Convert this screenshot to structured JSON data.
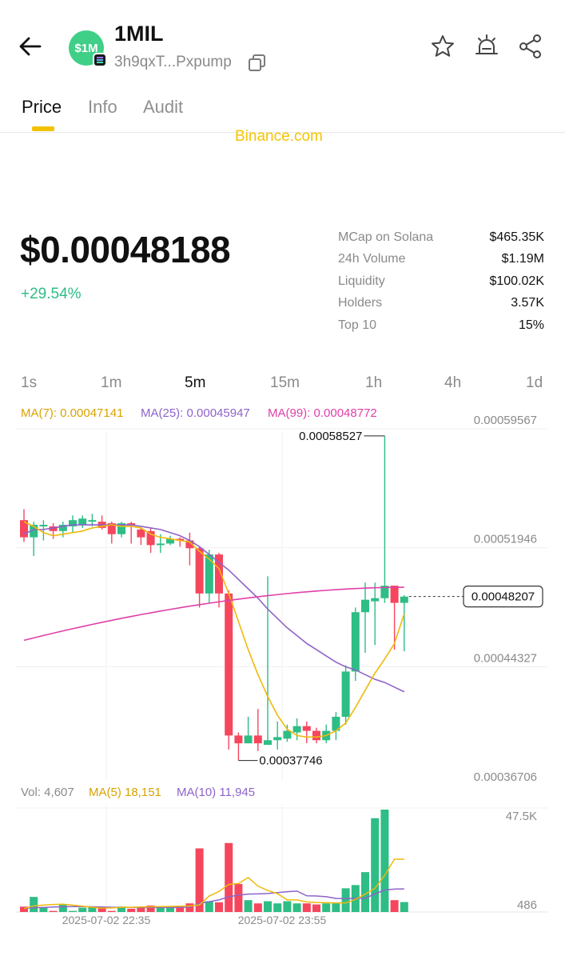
{
  "header": {
    "title": "1MIL",
    "avatar_text": "$1M",
    "address": "3h9qxT...Pxpump"
  },
  "tabs": [
    {
      "label": "Price"
    },
    {
      "label": "Info"
    },
    {
      "label": "Audit"
    }
  ],
  "banner": {
    "text": "Binance.com"
  },
  "price": {
    "value": "$0.00048188",
    "change": "+29.54%"
  },
  "stats": [
    {
      "label": "MCap on Solana",
      "value": "$465.35K"
    },
    {
      "label": "24h Volume",
      "value": "$1.19M"
    },
    {
      "label": "Liquidity",
      "value": "$100.02K"
    },
    {
      "label": "Holders",
      "value": "3.57K"
    },
    {
      "label": "Top 10",
      "value": "15%"
    }
  ],
  "intervals": [
    "1s",
    "1m",
    "5m",
    "15m",
    "1h",
    "4h",
    "1d"
  ],
  "selected_interval": "5m",
  "ma_legend": {
    "ma7": "MA(7): 0.00047141",
    "ma25": "MA(25): 0.00045947",
    "ma99": "MA(99): 0.00048772"
  },
  "vol_legend": {
    "vol": "Vol: 4,607",
    "ma5": "MA(5) 18,151",
    "ma10": "MA(10) 11,945"
  },
  "colors": {
    "up": "#2ebd85",
    "down": "#f6465d",
    "ma7": "#f0b90b",
    "ma25": "#8e63c9",
    "ma99": "#e040a8",
    "accent": "#f2c200"
  },
  "chart_data": {
    "type": "candlestick",
    "price_axis_labels": [
      "0.00059567",
      "0.00051946",
      "0.00044327",
      "0.00036706"
    ],
    "y_ticks": [
      0.00059567,
      0.00051946,
      0.00044327,
      0.00036706
    ],
    "high_label": "0.00058527",
    "low_label": "0.00037746",
    "current_label": "0.00048207",
    "current_price": 0.00048207,
    "time_labels": [
      "2025-07-02 22:35",
      "2025-07-02 23:55"
    ],
    "candles": [
      [
        0.000531,
        0.00052,
        0.000538,
        0.000517
      ],
      [
        0.00052,
        0.000528,
        0.00053,
        0.000508
      ],
      [
        0.000528,
        0.000528,
        0.000531,
        0.000518
      ],
      [
        0.000527,
        0.000524,
        0.000529,
        0.000519
      ],
      [
        0.000524,
        0.000528,
        0.00053,
        0.00052
      ],
      [
        0.000527,
        0.000531,
        0.000534,
        0.000523
      ],
      [
        0.000528,
        0.000532,
        0.000534,
        0.000526
      ],
      [
        0.000531,
        0.000531,
        0.000535,
        0.000527
      ],
      [
        0.00053,
        0.000526,
        0.000534,
        0.000525
      ],
      [
        0.000529,
        0.000522,
        0.00053,
        0.000516
      ],
      [
        0.000522,
        0.000529,
        0.00053,
        0.00052
      ],
      [
        0.000529,
        0.000528,
        0.00053,
        0.000516
      ],
      [
        0.000525,
        0.00052,
        0.000526,
        0.000515
      ],
      [
        0.000524,
        0.000515,
        0.000526,
        0.00051
      ],
      [
        0.000515,
        0.000516,
        0.000522,
        0.00051
      ],
      [
        0.000516,
        0.000519,
        0.000521,
        0.000515
      ],
      [
        0.000519,
        0.000518,
        0.00052,
        0.000514
      ],
      [
        0.000518,
        0.000513,
        0.000523,
        0.000502
      ],
      [
        0.000513,
        0.000484,
        0.000514,
        0.000475
      ],
      [
        0.000484,
        0.000509,
        0.000512,
        0.000478
      ],
      [
        0.000509,
        0.000484,
        0.00051,
        0.000475
      ],
      [
        0.000484,
        0.000393,
        0.000486,
        0.000384
      ],
      [
        0.000393,
        0.000388,
        0.000395,
        0.000377
      ],
      [
        0.000388,
        0.000393,
        0.000405,
        0.000388
      ],
      [
        0.000393,
        0.000388,
        0.00041,
        0.000383
      ],
      [
        0.000387,
        0.00039,
        0.000495,
        0.000387
      ],
      [
        0.00039,
        0.000392,
        0.000402,
        0.000384
      ],
      [
        0.000391,
        0.000396,
        0.0004,
        0.000389
      ],
      [
        0.000395,
        0.000399,
        0.000404,
        0.00039
      ],
      [
        0.000399,
        0.000396,
        0.000402,
        0.000388
      ],
      [
        0.000396,
        0.00039,
        0.000398,
        0.000388
      ],
      [
        0.00039,
        0.000396,
        0.0004,
        0.000388
      ],
      [
        0.000396,
        0.000405,
        0.000408,
        0.00039
      ],
      [
        0.000405,
        0.000434,
        0.000438,
        0.0004
      ],
      [
        0.000434,
        0.000472,
        0.000475,
        0.000428
      ],
      [
        0.000472,
        0.00048,
        0.000491,
        0.000446
      ],
      [
        0.000479,
        0.000481,
        0.000491,
        0.000451
      ],
      [
        0.000481,
        0.000489,
        0.000585,
        0.000478
      ],
      [
        0.000489,
        0.000478,
        0.000489,
        0.000448
      ],
      [
        0.000478,
        0.000482,
        0.000483,
        0.000447
      ]
    ],
    "ma7": [
      0.00053,
      0.000527,
      0.000523,
      0.000521,
      0.000522,
      0.000523,
      0.000524,
      0.000526,
      0.000527,
      0.000528,
      0.000527,
      0.000527,
      0.000526,
      0.000522,
      0.00052,
      0.000519,
      0.000518,
      0.000517,
      0.000511,
      0.000506,
      0.0005,
      0.000484,
      0.000466,
      0.000448,
      0.000432,
      0.000418,
      0.000406,
      0.000397,
      0.000393,
      0.000392,
      0.000392,
      0.000393,
      0.000396,
      0.000401,
      0.000411,
      0.000422,
      0.000433,
      0.000442,
      0.000452,
      0.000471
    ],
    "ma25": [
      0.000522,
      0.000525,
      0.000525,
      0.000526,
      0.000527,
      0.000528,
      0.000528,
      0.000528,
      0.000528,
      0.000528,
      0.000528,
      0.000528,
      0.000527,
      0.000526,
      0.000525,
      0.000523,
      0.000521,
      0.000518,
      0.000514,
      0.000509,
      0.000504,
      0.000499,
      0.000493,
      0.000487,
      0.000481,
      0.000474,
      0.000468,
      0.000462,
      0.000457,
      0.000452,
      0.000448,
      0.000444,
      0.00044,
      0.000437,
      0.000435,
      0.000432,
      0.000429,
      0.000427,
      0.000424,
      0.000421
    ],
    "ma99_start": 0.000454,
    "ma99_end": 0.000488,
    "volume_axis_labels": [
      "47.5K",
      "486"
    ],
    "volume_max": 47500,
    "volume_min": 486,
    "volumes": [
      2500,
      7000,
      2000,
      500,
      3500,
      500,
      2000,
      2500,
      2000,
      500,
      2500,
      1500,
      2000,
      3000,
      2000,
      2000,
      2500,
      4000,
      29500,
      5000,
      4500,
      32000,
      13000,
      5500,
      4000,
      5000,
      4000,
      5000,
      4000,
      4000,
      3500,
      4000,
      4000,
      11000,
      12500,
      18500,
      43500,
      47500,
      5500,
      4607
    ],
    "vol_ma5": [
      1600,
      2800,
      3200,
      3500,
      3600,
      3200,
      2700,
      2200,
      1800,
      1900,
      2200,
      2200,
      2300,
      2400,
      2500,
      2600,
      2700,
      2800,
      3300,
      7400,
      9500,
      12800,
      13200,
      16000,
      12000,
      10000,
      8500,
      5600,
      5600,
      4700,
      4400,
      4300,
      4200,
      4200,
      5800,
      8300,
      11000,
      17000,
      24500,
      24500
    ],
    "vol_ma10": [
      1800,
      2000,
      2100,
      2300,
      2400,
      2500,
      2500,
      2400,
      2300,
      2200,
      2200,
      2100,
      2100,
      2100,
      2100,
      2100,
      2200,
      2300,
      4000,
      4800,
      5600,
      7100,
      7800,
      8300,
      8400,
      8600,
      9000,
      9400,
      9700,
      7500,
      7400,
      7100,
      6300,
      6200,
      6300,
      6400,
      8400,
      10200,
      10600,
      10700
    ]
  }
}
